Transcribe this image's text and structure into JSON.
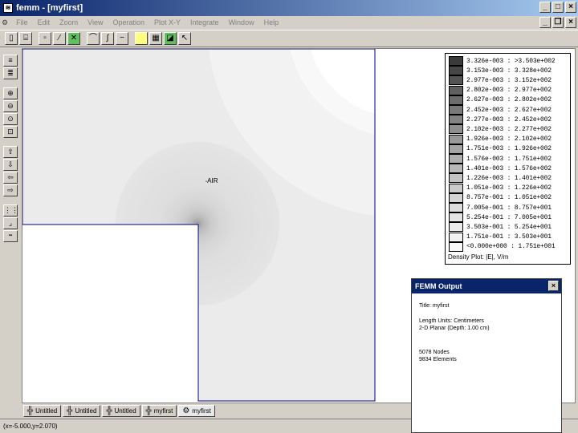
{
  "window": {
    "title": "femm - [myfirst]",
    "minimize": "_",
    "maximize": "□",
    "close": "×"
  },
  "menu": {
    "items": [
      "File",
      "Edit",
      "Zoom",
      "View",
      "Operation",
      "Plot X-Y",
      "Integrate",
      "Window",
      "Help"
    ],
    "mdi_minimize": "_",
    "mdi_restore": "❐",
    "mdi_close": "×"
  },
  "geometry_label": "AIR",
  "legend": {
    "rows": [
      "3.326e-003 : >3.503e+002",
      "3.153e-003 : 3.328e+002",
      "2.977e-003 : 3.152e+002",
      "2.802e-003 : 2.977e+002",
      "2.627e-003 : 2.802e+002",
      "2.452e-003 : 2.627e+002",
      "2.277e-003 : 2.452e+002",
      "2.102e-003 : 2.277e+002",
      "1.926e-003 : 2.102e+002",
      "1.751e-003 : 1.926e+002",
      "1.576e-003 : 1.751e+002",
      "1.401e-003 : 1.576e+002",
      "1.226e-003 : 1.401e+002",
      "1.051e-003 : 1.226e+002",
      "8.757e-001 : 1.051e+002",
      "7.005e-001 : 8.757e+001",
      "5.254e-001 : 7.005e+001",
      "3.503e-001 : 5.254e+001",
      "1.751e-001 : 3.503e+001",
      "<0.000e+000 : 1.751e+001"
    ],
    "colors": [
      "#3a3a3a",
      "#474747",
      "#545454",
      "#606060",
      "#6c6c6c",
      "#787878",
      "#838383",
      "#8e8e8e",
      "#999999",
      "#a4a4a4",
      "#aeaeae",
      "#b8b8b8",
      "#c2c2c2",
      "#cbcbcb",
      "#d4d4d4",
      "#dcdcdc",
      "#e4e4e4",
      "#ebebeb",
      "#f2f2f2",
      "#f8f8f8"
    ],
    "caption": "Density Plot: |E|, V/m"
  },
  "tabs": [
    {
      "label": "Untitled",
      "icon": "grid-icon"
    },
    {
      "label": "Untitled",
      "icon": "grid-icon"
    },
    {
      "label": "Untitled",
      "icon": "grid-icon"
    },
    {
      "label": "myfirst",
      "icon": "grid-icon"
    },
    {
      "label": "myfirst",
      "icon": "solution-icon",
      "active": true
    }
  ],
  "status": "(x=-5.000,y=2.070)",
  "output": {
    "title": "FEMM Output",
    "close": "×",
    "lines": [
      "Title: myfirst",
      "Length Units: Centimeters",
      "2-D Planar (Depth: 1.00 cm)",
      "5078 Nodes",
      "9834 Elements"
    ]
  }
}
